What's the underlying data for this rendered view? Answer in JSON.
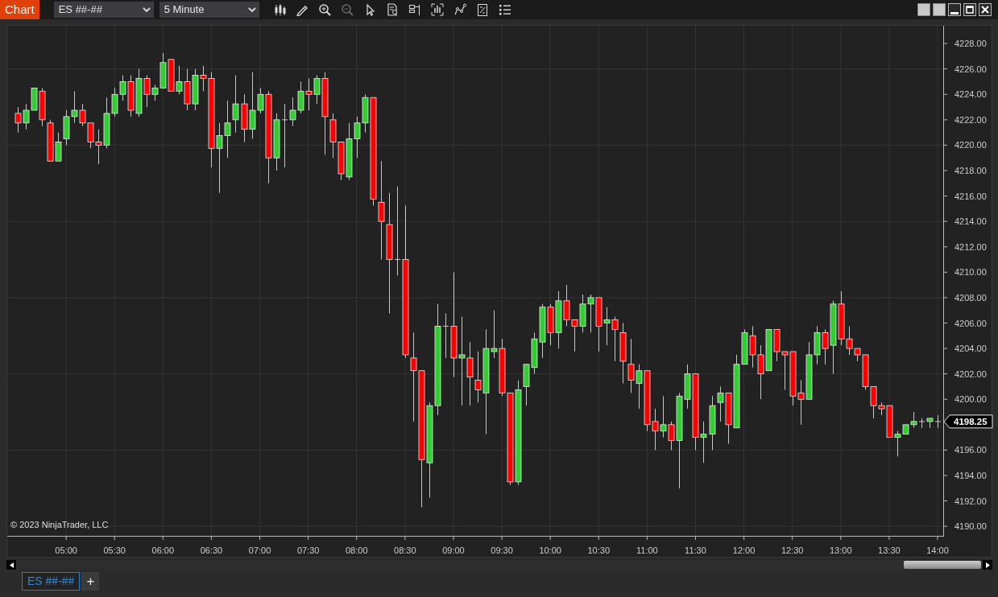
{
  "toolbar": {
    "title": "Chart",
    "instrument": "ES ##-##",
    "interval": "5 Minute",
    "tools": [
      {
        "kind": "candles",
        "disabled": false
      },
      {
        "kind": "pencil",
        "disabled": false
      },
      {
        "kind": "zoom-in",
        "disabled": false
      },
      {
        "kind": "zoom-out",
        "disabled": true
      },
      {
        "kind": "pointer",
        "disabled": false
      },
      {
        "kind": "document-search",
        "disabled": false
      },
      {
        "kind": "frame-rows",
        "disabled": false
      },
      {
        "kind": "bars-frame",
        "disabled": false
      },
      {
        "kind": "line-nodes",
        "disabled": false
      },
      {
        "kind": "report",
        "disabled": false
      },
      {
        "kind": "list",
        "disabled": false
      }
    ]
  },
  "chart": {
    "copyright": "© 2023 NinjaTrader, LLC",
    "last_price": "4198.25",
    "chart_data": {
      "type": "candlestick",
      "grid": true,
      "ylim": [
        4189.25,
        4229.4
      ],
      "categories": [
        null,
        null,
        null,
        null,
        null,
        null,
        "05:00",
        null,
        null,
        null,
        null,
        null,
        "05:30",
        null,
        null,
        null,
        null,
        null,
        "06:00",
        null,
        null,
        null,
        null,
        null,
        "06:30",
        null,
        null,
        null,
        null,
        null,
        "07:00",
        null,
        null,
        null,
        null,
        null,
        "07:30",
        null,
        null,
        null,
        null,
        null,
        "08:00",
        null,
        null,
        null,
        null,
        null,
        "08:30",
        null,
        null,
        null,
        null,
        null,
        "09:00",
        null,
        null,
        null,
        null,
        null,
        "09:30",
        null,
        null,
        null,
        null,
        null,
        "10:00",
        null,
        null,
        null,
        null,
        null,
        "10:30",
        null,
        null,
        null,
        null,
        null,
        "11:00",
        null,
        null,
        null,
        null,
        null,
        "11:30",
        null,
        null,
        null,
        null,
        null,
        "12:00",
        null,
        null,
        null,
        null,
        null,
        "12:30",
        null,
        null,
        null,
        null,
        null,
        "13:00",
        null,
        null,
        null,
        null,
        null,
        "13:30",
        null,
        null,
        null,
        null,
        null,
        "14:00"
      ],
      "yticks": [
        {
          "value": 4190,
          "label": "4190.00"
        },
        {
          "value": 4192,
          "label": "4192.00"
        },
        {
          "value": 4194,
          "label": "4194.00"
        },
        {
          "value": 4196,
          "label": "4196.00"
        },
        {
          "value": 4200,
          "label": "4200.00"
        },
        {
          "value": 4202,
          "label": "4202.00"
        },
        {
          "value": 4204,
          "label": "4204.00"
        },
        {
          "value": 4206,
          "label": "4206.00"
        },
        {
          "value": 4208,
          "label": "4208.00"
        },
        {
          "value": 4210,
          "label": "4210.00"
        },
        {
          "value": 4212,
          "label": "4212.00"
        },
        {
          "value": 4214,
          "label": "4214.00"
        },
        {
          "value": 4216,
          "label": "4216.00"
        },
        {
          "value": 4218,
          "label": "4218.00"
        },
        {
          "value": 4220,
          "label": "4220.00"
        },
        {
          "value": 4222,
          "label": "4222.00"
        },
        {
          "value": 4224,
          "label": "4224.00"
        },
        {
          "value": 4226,
          "label": "4226.00"
        },
        {
          "value": 4228,
          "label": "4228.00"
        }
      ],
      "ohlc": [
        [
          4222.5,
          4223,
          4221,
          4221.75
        ],
        [
          4221.75,
          4223.25,
          4221.25,
          4222.75
        ],
        [
          4222.75,
          4224.5,
          4222.75,
          4224.5
        ],
        [
          4224.25,
          4224.5,
          4221.5,
          4222
        ],
        [
          4221.75,
          4222,
          4218.75,
          4218.75
        ],
        [
          4218.75,
          4221,
          4218.75,
          4220.25
        ],
        [
          4220.5,
          4222.75,
          4220,
          4222.25
        ],
        [
          4222.25,
          4224.25,
          4221.75,
          4222.75
        ],
        [
          4222.75,
          4223.25,
          4221.5,
          4221.75
        ],
        [
          4221.75,
          4221.75,
          4219.75,
          4220.25
        ],
        [
          4220.25,
          4221.25,
          4218.5,
          4220
        ],
        [
          4220,
          4223.75,
          4219.75,
          4222.5
        ],
        [
          4222.5,
          4224.5,
          4222.25,
          4224
        ],
        [
          4224,
          4225.5,
          4223.5,
          4225
        ],
        [
          4225,
          4225.5,
          4222.25,
          4222.75
        ],
        [
          4222.5,
          4226,
          4222.25,
          4225.25
        ],
        [
          4225.25,
          4225.5,
          4223,
          4224
        ],
        [
          4224,
          4224.75,
          4223.5,
          4224.5
        ],
        [
          4224.5,
          4227.25,
          4224.5,
          4226.5
        ],
        [
          4226.75,
          4226.75,
          4224.25,
          4224.25
        ],
        [
          4224.25,
          4226.25,
          4224,
          4225
        ],
        [
          4225,
          4226,
          4222.75,
          4223.25
        ],
        [
          4223.25,
          4226,
          4222.75,
          4225.5
        ],
        [
          4225.5,
          4226.25,
          4224.25,
          4225.25
        ],
        [
          4225.25,
          4225.75,
          4218.25,
          4219.75
        ],
        [
          4219.75,
          4221.75,
          4216.25,
          4220.75
        ],
        [
          4220.75,
          4223.5,
          4219,
          4221.75
        ],
        [
          4222,
          4225.5,
          4221,
          4223.25
        ],
        [
          4223.25,
          4224,
          4220.25,
          4221.25
        ],
        [
          4221.25,
          4225.75,
          4220.5,
          4222.75
        ],
        [
          4222.75,
          4224.5,
          4222.5,
          4224
        ],
        [
          4224,
          4224.25,
          4217,
          4219
        ],
        [
          4219,
          4222.5,
          4218,
          4222
        ],
        [
          4222,
          4223.25,
          4218.25,
          4222
        ],
        [
          4222,
          4223.75,
          4221.5,
          4222.75
        ],
        [
          4222.75,
          4225,
          4222.5,
          4224.25
        ],
        [
          4224.25,
          4225.25,
          4222.75,
          4224
        ],
        [
          4224,
          4225.5,
          4223.25,
          4225.25
        ],
        [
          4225.25,
          4225.75,
          4219.25,
          4222.25
        ],
        [
          4222,
          4222.5,
          4219,
          4220.25
        ],
        [
          4220.25,
          4220.25,
          4217.25,
          4217.75
        ],
        [
          4217.5,
          4221.75,
          4217.25,
          4220.5
        ],
        [
          4220.5,
          4222.25,
          4219,
          4221.75
        ],
        [
          4221.75,
          4224,
          4221,
          4223.75
        ],
        [
          4223.75,
          4223.75,
          4215.25,
          4215.75
        ],
        [
          4215.5,
          4218.75,
          4211,
          4214
        ],
        [
          4213.75,
          4216.25,
          4206.75,
          4211
        ],
        [
          4211,
          4216.75,
          4209.75,
          4211
        ],
        [
          4211,
          4215.25,
          4203.25,
          4203.5
        ],
        [
          4203.25,
          4205.25,
          4198.25,
          4202.25
        ],
        [
          4202.25,
          4202.25,
          4191.5,
          4195.25
        ],
        [
          4195,
          4199.75,
          4192.25,
          4199.5
        ],
        [
          4199.5,
          4207.5,
          4198.75,
          4205.75
        ],
        [
          4205.75,
          4206.75,
          4203.25,
          4205.75
        ],
        [
          4205.75,
          4210,
          4201.75,
          4203.25
        ],
        [
          4203.25,
          4206.5,
          4199.5,
          4203.5
        ],
        [
          4203.25,
          4204.5,
          4199.5,
          4201.75
        ],
        [
          4201.5,
          4203.75,
          4199.75,
          4200.75
        ],
        [
          4200.5,
          4205.5,
          4197.25,
          4204
        ],
        [
          4203.75,
          4207,
          4203.25,
          4204
        ],
        [
          4204,
          4204.75,
          4200.25,
          4200.5
        ],
        [
          4200.5,
          4200.5,
          4193.25,
          4193.5
        ],
        [
          4193.5,
          4201.5,
          4193.25,
          4200.75
        ],
        [
          4201,
          4202.75,
          4199.5,
          4202.75
        ],
        [
          4202.5,
          4205.25,
          4202,
          4204.75
        ],
        [
          4204.5,
          4207.5,
          4203.25,
          4207.25
        ],
        [
          4207.25,
          4207.5,
          4204.25,
          4205.25
        ],
        [
          4205.25,
          4208.5,
          4204,
          4207.75
        ],
        [
          4207.75,
          4209,
          4205.75,
          4206.25
        ],
        [
          4206.25,
          4206.25,
          4203.75,
          4205.75
        ],
        [
          4205.75,
          4208.25,
          4205.25,
          4207.5
        ],
        [
          4207.5,
          4208.25,
          4205.25,
          4208
        ],
        [
          4208,
          4208,
          4203.75,
          4205.75
        ],
        [
          4206,
          4207.25,
          4204.25,
          4206.25
        ],
        [
          4206.25,
          4206.5,
          4203,
          4205.5
        ],
        [
          4205.25,
          4206,
          4201.25,
          4203
        ],
        [
          4202.75,
          4204.75,
          4200.5,
          4201.5
        ],
        [
          4201.25,
          4202.75,
          4199.25,
          4202.25
        ],
        [
          4202.25,
          4202.25,
          4197.5,
          4198
        ],
        [
          4198.25,
          4199.25,
          4196,
          4197.5
        ],
        [
          4197.5,
          4200.25,
          4197,
          4198
        ],
        [
          4198,
          4198.25,
          4196,
          4196.75
        ],
        [
          4196.75,
          4200.5,
          4193,
          4200.25
        ],
        [
          4200,
          4202.75,
          4199.25,
          4202
        ],
        [
          4202,
          4202,
          4196,
          4197
        ],
        [
          4197,
          4198.25,
          4195,
          4197.25
        ],
        [
          4197.25,
          4200.25,
          4196,
          4199.5
        ],
        [
          4199.75,
          4201,
          4198.25,
          4200.5
        ],
        [
          4200.5,
          4200.5,
          4196.5,
          4198
        ],
        [
          4197.75,
          4203.5,
          4197.75,
          4202.75
        ],
        [
          4202.75,
          4205.5,
          4202.75,
          4205.25
        ],
        [
          4205,
          4205.75,
          4202.5,
          4203.5
        ],
        [
          4203.5,
          4204.25,
          4200,
          4202
        ],
        [
          4202.25,
          4205.5,
          4202.25,
          4205.5
        ],
        [
          4205.5,
          4205.5,
          4203,
          4203.75
        ],
        [
          4203.75,
          4203.75,
          4200.75,
          4203.5
        ],
        [
          4203.75,
          4203.75,
          4199.5,
          4200.25
        ],
        [
          4200.5,
          4201.5,
          4198,
          4200
        ],
        [
          4200,
          4204.5,
          4200,
          4203.5
        ],
        [
          4203.5,
          4205.75,
          4202.75,
          4205.25
        ],
        [
          4205.25,
          4205.5,
          4202.75,
          4204
        ],
        [
          4204.25,
          4207.75,
          4202,
          4207.5
        ],
        [
          4207.5,
          4208.5,
          4204.25,
          4204.75
        ],
        [
          4204.75,
          4205.75,
          4203.5,
          4204
        ],
        [
          4204,
          4204,
          4203,
          4203.5
        ],
        [
          4203.5,
          4203.5,
          4200.75,
          4201
        ],
        [
          4201,
          4201,
          4198.5,
          4199.5
        ],
        [
          4199.5,
          4199.75,
          4198.75,
          4199.25
        ],
        [
          4199.5,
          4199.5,
          4197,
          4197
        ],
        [
          4197,
          4197.5,
          4195.5,
          4197.25
        ],
        [
          4197.25,
          4198,
          4197.25,
          4198
        ],
        [
          4198,
          4199,
          4197.75,
          4198.25
        ],
        [
          4198.25,
          4198.5,
          4197.75,
          4198.25
        ],
        [
          4198.25,
          4198.5,
          4197.75,
          4198.5
        ],
        [
          4198.25,
          4198.75,
          4197.75,
          4198.25
        ]
      ]
    }
  },
  "tabs": [
    {
      "label": "ES ##-##",
      "selected": true
    }
  ],
  "add_tab": "+"
}
